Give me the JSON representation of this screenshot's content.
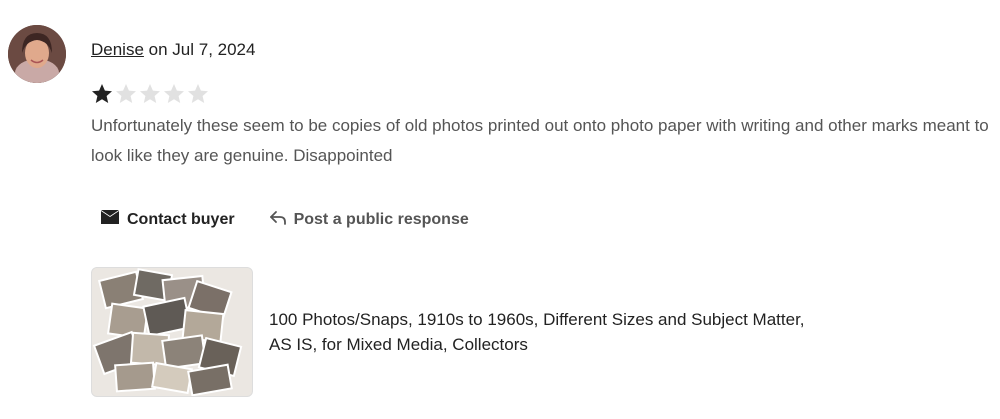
{
  "review": {
    "reviewer_name": "Denise",
    "date_prefix": " on ",
    "date": "Jul 7, 2024",
    "rating": 1,
    "rating_max": 5,
    "text": "Unfortunately these seem to be copies of old photos printed out onto photo paper with writing and other marks meant to look like they are genuine. Disappointed"
  },
  "actions": {
    "contact_label": "Contact buyer",
    "respond_label": "Post a public response"
  },
  "product": {
    "title": "100 Photos/Snaps, 1910s to 1960s, Different Sizes and Subject Matter, AS IS, for Mixed Media, Collectors"
  },
  "icons": {
    "contact": "envelope-icon",
    "respond": "reply-arrow-icon"
  },
  "colors": {
    "star_filled": "#222222",
    "star_empty": "#e1e1e1"
  }
}
